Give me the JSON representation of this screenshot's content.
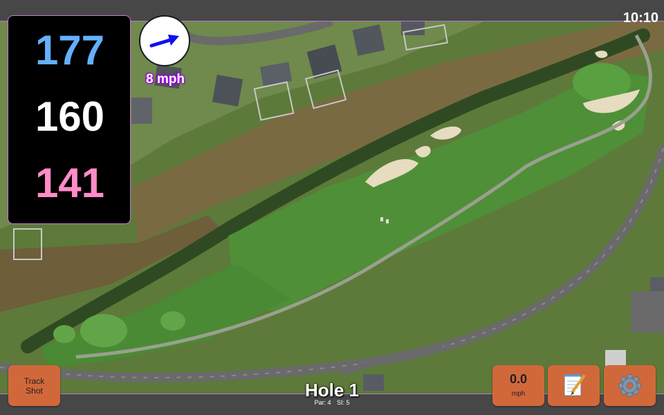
{
  "status": {
    "time": "10:10"
  },
  "distances": {
    "back": "177",
    "middle": "160",
    "front": "141"
  },
  "wind": {
    "speed_label": "8 mph",
    "direction_icon": "arrow-icon"
  },
  "buttons": {
    "track_shot": {
      "line1": "Track",
      "line2": "Shot"
    },
    "wind_speed": {
      "value": "0.0",
      "unit": "mph"
    },
    "notes_icon": "notepad-icon",
    "settings_icon": "gear-icon"
  },
  "hole": {
    "title": "Hole 1",
    "par": "Par: 4",
    "si": "SI: 5"
  },
  "colors": {
    "back_distance": "#64b0ff",
    "middle_distance": "#ffffff",
    "front_distance": "#ff8cc6",
    "button": "#d1683a",
    "accent_border": "#cc77dd"
  }
}
